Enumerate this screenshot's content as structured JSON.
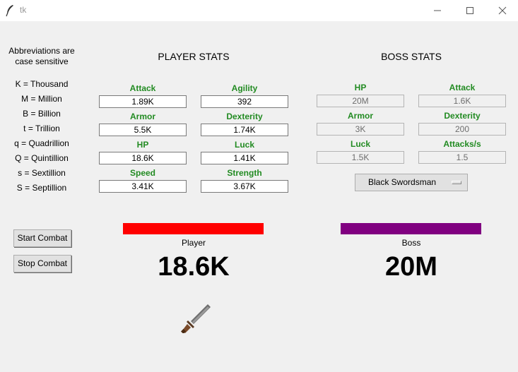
{
  "window": {
    "title": "tk"
  },
  "abbreviations": {
    "note": [
      "Abbreviations are",
      "case sensitive"
    ],
    "items": [
      "K = Thousand",
      "M = Million",
      "B = Billion",
      "t = Trillion",
      "q = Quadrillion",
      "Q = Quintillion",
      "s = Sextillion",
      "S = Septillion"
    ]
  },
  "player": {
    "heading": "PLAYER STATS",
    "stats": [
      {
        "label": "Attack",
        "value": "1.89K"
      },
      {
        "label": "Agility",
        "value": "392"
      },
      {
        "label": "Armor",
        "value": "5.5K"
      },
      {
        "label": "Dexterity",
        "value": "1.74K"
      },
      {
        "label": "HP",
        "value": "18.6K"
      },
      {
        "label": "Luck",
        "value": "1.41K"
      },
      {
        "label": "Speed",
        "value": "3.41K"
      },
      {
        "label": "Strength",
        "value": "3.67K"
      }
    ],
    "bar_label": "Player",
    "bar_color": "#ff0000",
    "bar_fill": 1.0,
    "hp_display": "18.6K"
  },
  "boss": {
    "heading": "BOSS STATS",
    "stats": [
      {
        "label": "HP",
        "value": "20M"
      },
      {
        "label": "Attack",
        "value": "1.6K"
      },
      {
        "label": "Armor",
        "value": "3K"
      },
      {
        "label": "Dexterity",
        "value": "200"
      },
      {
        "label": "Luck",
        "value": "1.5K"
      },
      {
        "label": "Attacks/s",
        "value": "1.5"
      }
    ],
    "selected": "Black Swordsman",
    "bar_label": "Boss",
    "bar_color": "#800080",
    "bar_fill": 1.0,
    "hp_display": "20M"
  },
  "buttons": {
    "start": "Start Combat",
    "stop": "Stop Combat"
  },
  "colors": {
    "label_green": "#228b22",
    "window_bg": "#f0f0f0"
  },
  "icons": {
    "app": "feather-icon",
    "combat": "sword-icon"
  }
}
